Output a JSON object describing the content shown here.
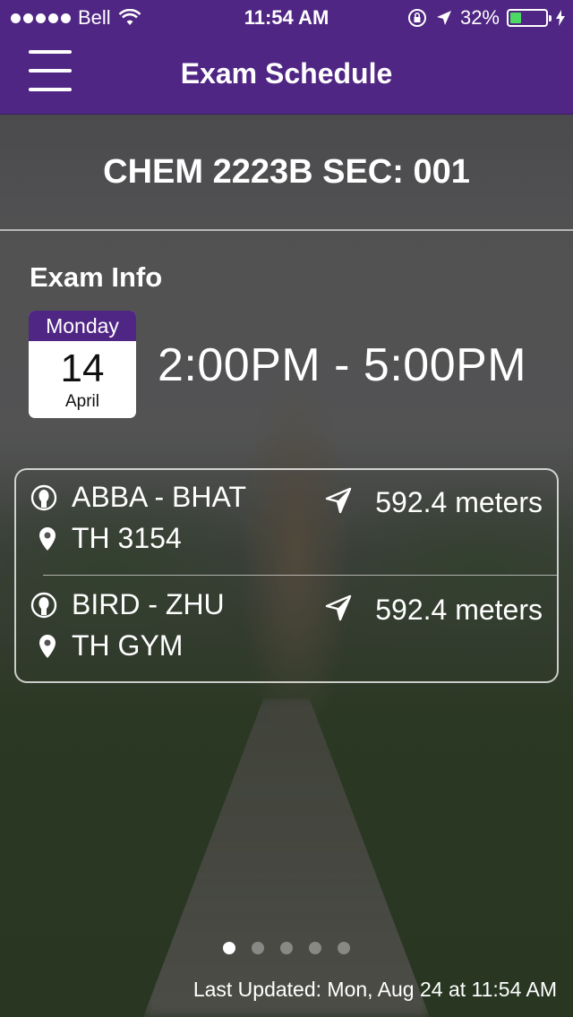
{
  "status_bar": {
    "carrier": "Bell",
    "time": "11:54 AM",
    "battery": "32%",
    "battery_level": 0.32,
    "signal_bars": 5
  },
  "nav": {
    "title": "Exam Schedule",
    "menu_icon": "hamburger-menu-icon"
  },
  "course": {
    "code": "CHEM 2223B SEC: 001"
  },
  "exam": {
    "section_label": "Exam Info",
    "weekday": "Monday",
    "day": "14",
    "month": "April",
    "time_range": "2:00PM - 5:00PM"
  },
  "locations": [
    {
      "range": "ABBA - BHAT",
      "room": "TH 3154",
      "distance": "592.4 meters"
    },
    {
      "range": "BIRD - ZHU",
      "room": "TH GYM",
      "distance": "592.4 meters"
    }
  ],
  "pager": {
    "count": 5,
    "active": 0
  },
  "footer": {
    "last_updated": "Last Updated: Mon, Aug 24 at 11:54 AM"
  },
  "colors": {
    "accent": "#4f2683",
    "battery_fill": "#4cd964"
  }
}
